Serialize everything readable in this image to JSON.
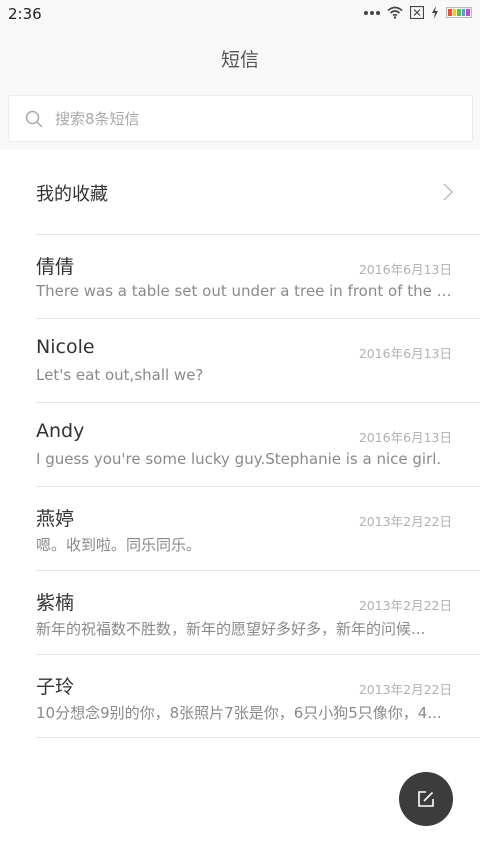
{
  "status_bar": {
    "time": "2:36",
    "icons": [
      "more-dots-icon",
      "wifi-icon",
      "sim-card-icon",
      "charging-icon",
      "battery-icon"
    ],
    "battery_colors": [
      "#e94b3c",
      "#f3c623",
      "#5fbf4a",
      "#4aa3df",
      "#c04bd8"
    ]
  },
  "header": {
    "title": "短信"
  },
  "search": {
    "placeholder": "搜索8条短信"
  },
  "favorites": {
    "label": "我的收藏"
  },
  "messages": [
    {
      "name": "倩倩",
      "date": "2016年6月13日",
      "preview": "There was a table set out under a tree in front of the ho..."
    },
    {
      "name": "Nicole",
      "date": "2016年6月13日",
      "preview": "Let's eat out,shall we?"
    },
    {
      "name": "Andy",
      "date": "2016年6月13日",
      "preview": "I guess you're some lucky guy.Stephanie is a nice girl."
    },
    {
      "name": "燕婷",
      "date": "2013年2月22日",
      "preview": "嗯。收到啦。同乐同乐。"
    },
    {
      "name": "紫楠",
      "date": "2013年2月22日",
      "preview": "新年的祝福数不胜数，新年的愿望好多好多，新年的问候..."
    },
    {
      "name": "子玲",
      "date": "2013年2月22日",
      "preview": "10分想念9别的你，8张照片7张是你，6只小狗5只像你，4..."
    }
  ],
  "compose": {
    "icon": "compose-icon",
    "background": "#3c3c3c"
  }
}
